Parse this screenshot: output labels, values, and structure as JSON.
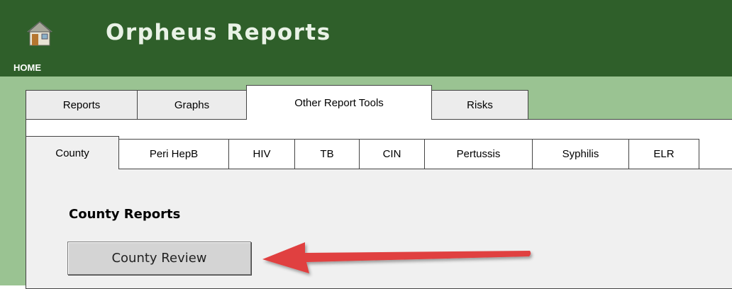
{
  "header": {
    "title": "Orpheus Reports",
    "home_label": "HOME",
    "bg_color": "#2f5f2a"
  },
  "main_tabs": [
    {
      "label": "Reports",
      "active": false
    },
    {
      "label": "Graphs",
      "active": false
    },
    {
      "label": "Other Report Tools",
      "active": true
    },
    {
      "label": "Risks",
      "active": false
    }
  ],
  "sub_tabs": [
    {
      "label": "County",
      "active": true
    },
    {
      "label": "Peri HepB",
      "active": false
    },
    {
      "label": "HIV",
      "active": false
    },
    {
      "label": "TB",
      "active": false
    },
    {
      "label": "CIN",
      "active": false
    },
    {
      "label": "Pertussis",
      "active": false
    },
    {
      "label": "Syphilis",
      "active": false
    },
    {
      "label": "ELR",
      "active": false
    }
  ],
  "content": {
    "section_heading": "County Reports",
    "review_button_label": "County Review"
  },
  "annotation": {
    "arrow_color": "#e0403f",
    "arrow_points_to": "County Review"
  },
  "icons": [
    "home-icon",
    "annotation-arrow-icon"
  ],
  "colors": {
    "outer_band": "#9ac392",
    "sub_panel": "#f0f0f0"
  }
}
